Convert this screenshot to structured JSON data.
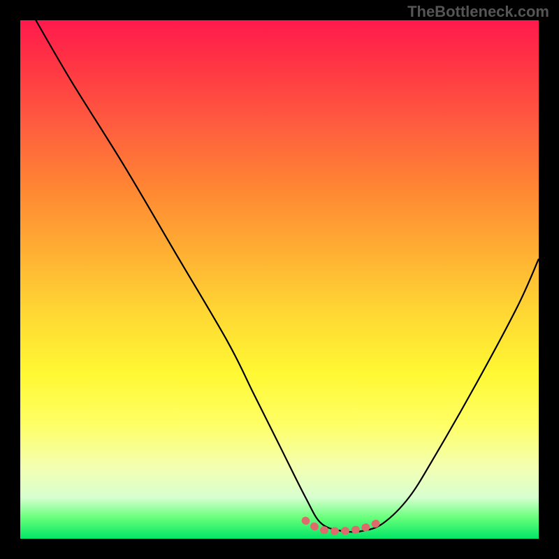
{
  "watermark": "TheBottleneck.com",
  "chart_data": {
    "type": "line",
    "title": "",
    "xlabel": "",
    "ylabel": "",
    "xlim": [
      0,
      100
    ],
    "ylim": [
      0,
      100
    ],
    "grid": false,
    "legend": false,
    "series": [
      {
        "name": "curve",
        "color": "#000000",
        "x": [
          3,
          10,
          20,
          30,
          40,
          45,
          50,
          55,
          58,
          62,
          66,
          70,
          75,
          80,
          88,
          96,
          100
        ],
        "y": [
          100,
          88,
          72,
          55,
          38,
          28,
          18,
          8,
          3,
          1.5,
          1.5,
          3,
          8,
          16,
          30,
          45,
          54
        ]
      },
      {
        "name": "flat-bottom-marker",
        "color": "#e06666",
        "x": [
          55,
          58,
          62,
          66,
          70
        ],
        "y": [
          3.5,
          1.8,
          1.5,
          2,
          3.5
        ]
      }
    ],
    "annotations": []
  }
}
